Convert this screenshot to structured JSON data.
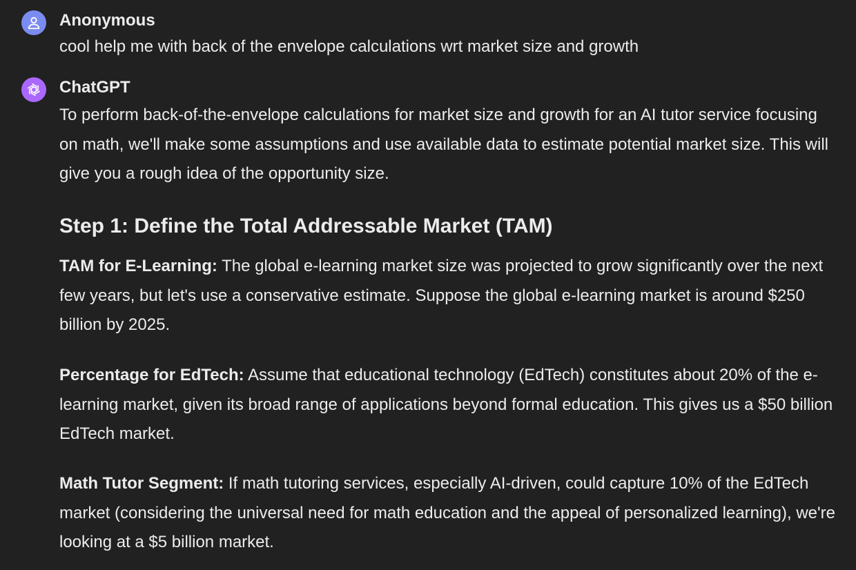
{
  "user_message": {
    "author": "Anonymous",
    "text": "cool help me with back of the envelope calculations wrt market size and growth"
  },
  "assistant_message": {
    "author": "ChatGPT",
    "intro": "To perform back-of-the-envelope calculations for market size and growth for an AI tutor service focusing on math, we'll make some assumptions and use available data to estimate potential market size. This will give you a rough idea of the opportunity size.",
    "heading": "Step 1: Define the Total Addressable Market (TAM)",
    "items": [
      {
        "label": "TAM for E-Learning:",
        "text": " The global e-learning market size was projected to grow significantly over the next few years, but let's use a conservative estimate. Suppose the global e-learning market is around $250 billion by 2025."
      },
      {
        "label": "Percentage for EdTech:",
        "text": " Assume that educational technology (EdTech) constitutes about 20% of the e-learning market, given its broad range of applications beyond formal education. This gives us a $50 billion EdTech market."
      },
      {
        "label": "Math Tutor Segment:",
        "text": " If math tutoring services, especially AI-driven, could capture 10% of the EdTech market (considering the universal need for math education and the appeal of personalized learning), we're looking at a $5 billion market."
      }
    ]
  },
  "icons": {
    "user_avatar": "user-icon",
    "assistant_avatar": "openai-logo-icon"
  },
  "colors": {
    "background": "#212121",
    "text": "#ececec",
    "user_avatar_bg": "#7b8cf0",
    "assistant_avatar_bg": "#ab68ff"
  }
}
